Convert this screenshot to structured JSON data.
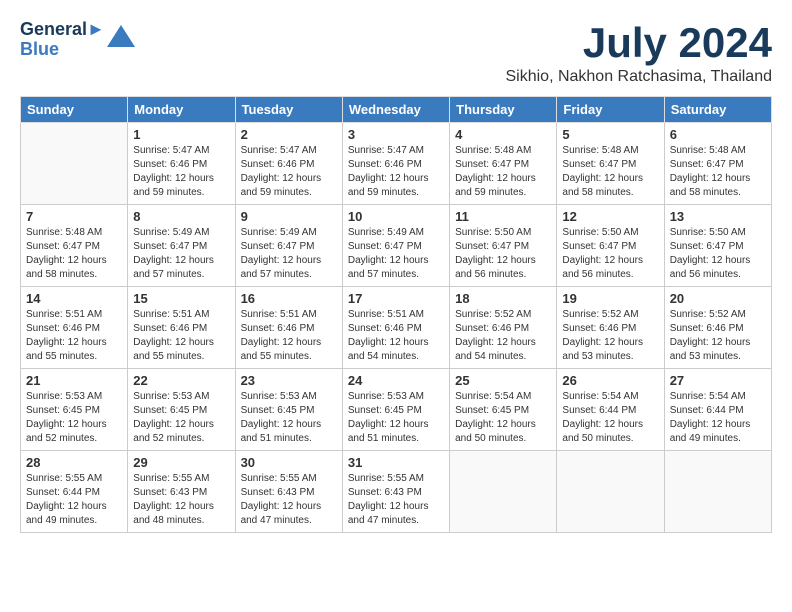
{
  "header": {
    "logo_line1": "General",
    "logo_line2": "Blue",
    "month": "July 2024",
    "location": "Sikhio, Nakhon Ratchasima, Thailand"
  },
  "weekdays": [
    "Sunday",
    "Monday",
    "Tuesday",
    "Wednesday",
    "Thursday",
    "Friday",
    "Saturday"
  ],
  "weeks": [
    [
      {
        "day": "",
        "content": ""
      },
      {
        "day": "1",
        "content": "Sunrise: 5:47 AM\nSunset: 6:46 PM\nDaylight: 12 hours\nand 59 minutes."
      },
      {
        "day": "2",
        "content": "Sunrise: 5:47 AM\nSunset: 6:46 PM\nDaylight: 12 hours\nand 59 minutes."
      },
      {
        "day": "3",
        "content": "Sunrise: 5:47 AM\nSunset: 6:46 PM\nDaylight: 12 hours\nand 59 minutes."
      },
      {
        "day": "4",
        "content": "Sunrise: 5:48 AM\nSunset: 6:47 PM\nDaylight: 12 hours\nand 59 minutes."
      },
      {
        "day": "5",
        "content": "Sunrise: 5:48 AM\nSunset: 6:47 PM\nDaylight: 12 hours\nand 58 minutes."
      },
      {
        "day": "6",
        "content": "Sunrise: 5:48 AM\nSunset: 6:47 PM\nDaylight: 12 hours\nand 58 minutes."
      }
    ],
    [
      {
        "day": "7",
        "content": "Sunrise: 5:48 AM\nSunset: 6:47 PM\nDaylight: 12 hours\nand 58 minutes."
      },
      {
        "day": "8",
        "content": "Sunrise: 5:49 AM\nSunset: 6:47 PM\nDaylight: 12 hours\nand 57 minutes."
      },
      {
        "day": "9",
        "content": "Sunrise: 5:49 AM\nSunset: 6:47 PM\nDaylight: 12 hours\nand 57 minutes."
      },
      {
        "day": "10",
        "content": "Sunrise: 5:49 AM\nSunset: 6:47 PM\nDaylight: 12 hours\nand 57 minutes."
      },
      {
        "day": "11",
        "content": "Sunrise: 5:50 AM\nSunset: 6:47 PM\nDaylight: 12 hours\nand 56 minutes."
      },
      {
        "day": "12",
        "content": "Sunrise: 5:50 AM\nSunset: 6:47 PM\nDaylight: 12 hours\nand 56 minutes."
      },
      {
        "day": "13",
        "content": "Sunrise: 5:50 AM\nSunset: 6:47 PM\nDaylight: 12 hours\nand 56 minutes."
      }
    ],
    [
      {
        "day": "14",
        "content": "Sunrise: 5:51 AM\nSunset: 6:46 PM\nDaylight: 12 hours\nand 55 minutes."
      },
      {
        "day": "15",
        "content": "Sunrise: 5:51 AM\nSunset: 6:46 PM\nDaylight: 12 hours\nand 55 minutes."
      },
      {
        "day": "16",
        "content": "Sunrise: 5:51 AM\nSunset: 6:46 PM\nDaylight: 12 hours\nand 55 minutes."
      },
      {
        "day": "17",
        "content": "Sunrise: 5:51 AM\nSunset: 6:46 PM\nDaylight: 12 hours\nand 54 minutes."
      },
      {
        "day": "18",
        "content": "Sunrise: 5:52 AM\nSunset: 6:46 PM\nDaylight: 12 hours\nand 54 minutes."
      },
      {
        "day": "19",
        "content": "Sunrise: 5:52 AM\nSunset: 6:46 PM\nDaylight: 12 hours\nand 53 minutes."
      },
      {
        "day": "20",
        "content": "Sunrise: 5:52 AM\nSunset: 6:46 PM\nDaylight: 12 hours\nand 53 minutes."
      }
    ],
    [
      {
        "day": "21",
        "content": "Sunrise: 5:53 AM\nSunset: 6:45 PM\nDaylight: 12 hours\nand 52 minutes."
      },
      {
        "day": "22",
        "content": "Sunrise: 5:53 AM\nSunset: 6:45 PM\nDaylight: 12 hours\nand 52 minutes."
      },
      {
        "day": "23",
        "content": "Sunrise: 5:53 AM\nSunset: 6:45 PM\nDaylight: 12 hours\nand 51 minutes."
      },
      {
        "day": "24",
        "content": "Sunrise: 5:53 AM\nSunset: 6:45 PM\nDaylight: 12 hours\nand 51 minutes."
      },
      {
        "day": "25",
        "content": "Sunrise: 5:54 AM\nSunset: 6:45 PM\nDaylight: 12 hours\nand 50 minutes."
      },
      {
        "day": "26",
        "content": "Sunrise: 5:54 AM\nSunset: 6:44 PM\nDaylight: 12 hours\nand 50 minutes."
      },
      {
        "day": "27",
        "content": "Sunrise: 5:54 AM\nSunset: 6:44 PM\nDaylight: 12 hours\nand 49 minutes."
      }
    ],
    [
      {
        "day": "28",
        "content": "Sunrise: 5:55 AM\nSunset: 6:44 PM\nDaylight: 12 hours\nand 49 minutes."
      },
      {
        "day": "29",
        "content": "Sunrise: 5:55 AM\nSunset: 6:43 PM\nDaylight: 12 hours\nand 48 minutes."
      },
      {
        "day": "30",
        "content": "Sunrise: 5:55 AM\nSunset: 6:43 PM\nDaylight: 12 hours\nand 47 minutes."
      },
      {
        "day": "31",
        "content": "Sunrise: 5:55 AM\nSunset: 6:43 PM\nDaylight: 12 hours\nand 47 minutes."
      },
      {
        "day": "",
        "content": ""
      },
      {
        "day": "",
        "content": ""
      },
      {
        "day": "",
        "content": ""
      }
    ]
  ]
}
